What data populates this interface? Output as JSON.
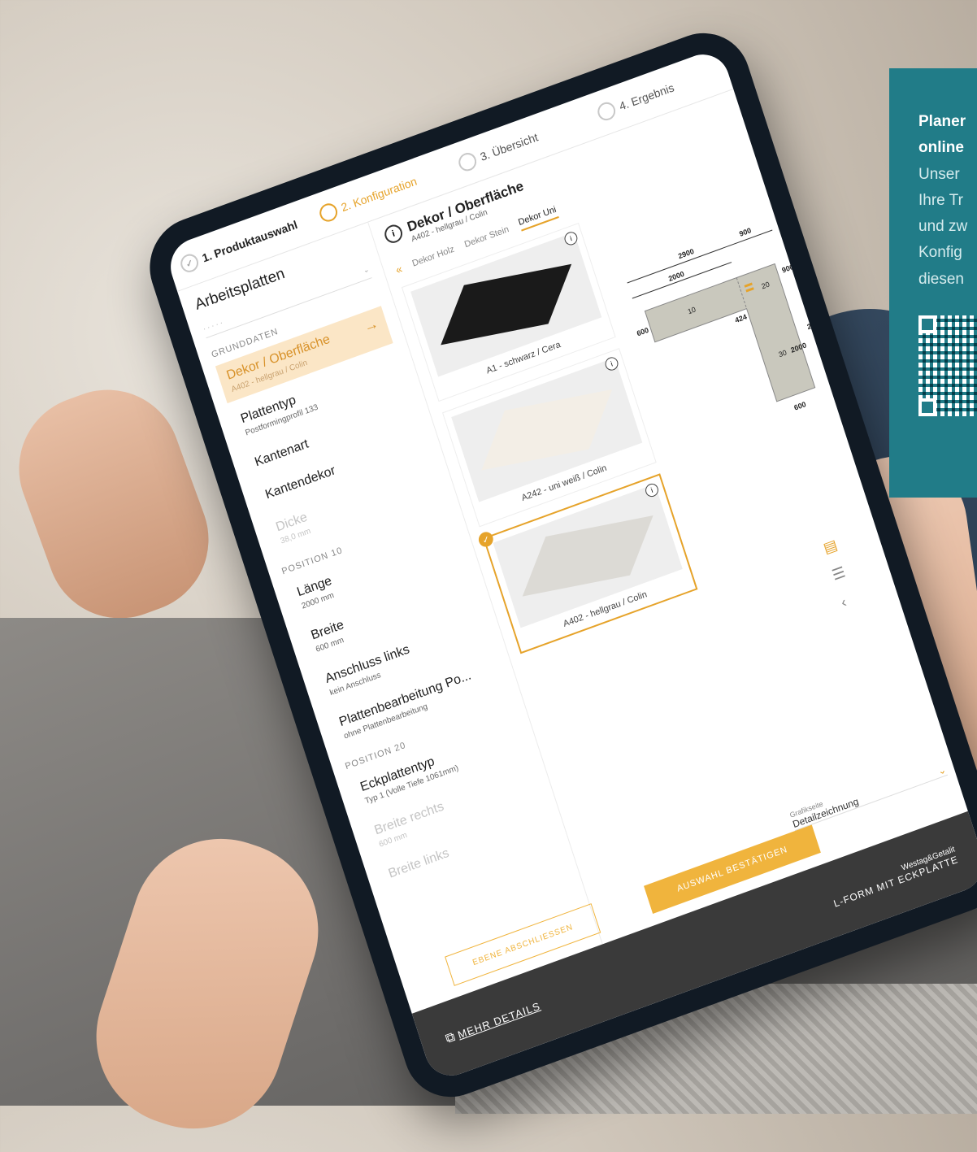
{
  "steps": [
    {
      "label": "1. Produktauswahl",
      "icon": "check-icon"
    },
    {
      "label": "2. Konfiguration",
      "icon": "circle-icon"
    },
    {
      "label": "3. Übersicht",
      "icon": "circle-icon"
    },
    {
      "label": "4. Ergebnis",
      "icon": "circle-icon"
    }
  ],
  "sidebar": {
    "title": "Arbeitsplatten",
    "section1": "GRUNDDATEN",
    "items": [
      {
        "label": "Dekor / Oberfläche",
        "value": "A402 - hellgrau / Colin"
      },
      {
        "label": "Plattentyp",
        "value": "Postformingprofil 133"
      },
      {
        "label": "Kantenart",
        "value": ""
      },
      {
        "label": "Kantendekor",
        "value": ""
      },
      {
        "label": "Dicke",
        "value": "38,0 mm"
      }
    ],
    "section2": "POSITION 10",
    "pos10": [
      {
        "label": "Länge",
        "value": "2000 mm"
      },
      {
        "label": "Breite",
        "value": "600 mm"
      },
      {
        "label": "Anschluss links",
        "value": "kein Anschluss"
      },
      {
        "label": "Plattenbearbeitung Po...",
        "value": "ohne Plattenbearbeitung"
      }
    ],
    "section3": "POSITION 20",
    "pos20": [
      {
        "label": "Eckplattentyp",
        "value": "Typ 1 (Volle Tiefe 1061mm)"
      },
      {
        "label": "Breite rechts",
        "value": "600 mm"
      },
      {
        "label": "Breite links",
        "value": ""
      }
    ]
  },
  "main": {
    "title": "Dekor / Oberfläche",
    "subtitle": "A402 - hellgrau / Colin",
    "tabs": [
      "Dekor Holz",
      "Dekor Stein",
      "Dekor Uni"
    ],
    "cards": [
      {
        "caption": "A1 - schwarz / Cera",
        "color": "#1a1a1a"
      },
      {
        "caption": "A242 - uni weiß / Colin",
        "color": "#f3eee6"
      },
      {
        "caption": "A402 - hellgrau / Colin",
        "color": "#dcdad5"
      }
    ]
  },
  "drawing": {
    "dims": [
      "2900",
      "900",
      "2000",
      "900",
      "600",
      "2900",
      "2000",
      "600",
      "424",
      "10",
      "20",
      "30"
    ]
  },
  "grafik": {
    "label": "Grafikseite",
    "value": "Detailzeichnung"
  },
  "buttons": {
    "confirm": "AUSWAHL BESTÄTIGEN",
    "close_level": "EBENE ABSCHLIESSEN"
  },
  "footer": {
    "more": "MEHR DETAILS",
    "brand": "Westag&Getalit",
    "product": "L-FORM MIT ECKPLATTE"
  },
  "promo": {
    "lines_bold": [
      "Planer",
      "online"
    ],
    "lines": [
      "Unser",
      "Ihre Tr",
      "und zw",
      "Konfig",
      "diesen"
    ]
  },
  "colors": {
    "accent": "#e6a32a",
    "teal": "#217c88",
    "footer": "#3a3a3a"
  }
}
